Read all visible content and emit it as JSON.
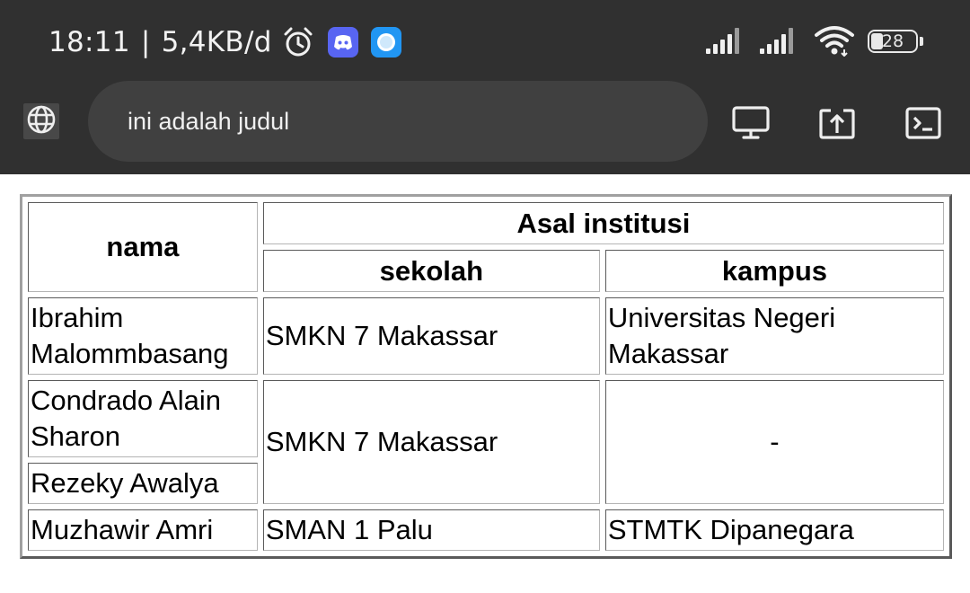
{
  "status_bar": {
    "time": "18:11",
    "separator": "|",
    "net_speed": "5,4KB/d",
    "battery_level": "28",
    "battery_fraction": 0.28
  },
  "toolbar": {
    "url_text": "ini adalah judul"
  },
  "table": {
    "header": {
      "nama": "nama",
      "asal": "Asal institusi",
      "sekolah": "sekolah",
      "kampus": "kampus"
    },
    "rows": [
      {
        "nama": "Ibrahim Malommbasang",
        "sekolah": "SMKN 7 Makassar",
        "kampus": "Universitas Negeri Makassar"
      },
      {
        "nama": "Condrado Alain Sharon",
        "sekolah": "SMKN 7 Makassar",
        "kampus": "-"
      },
      {
        "nama": "Rezeky Awalya"
      },
      {
        "nama": "Muzhawir Amri",
        "sekolah": "SMAN 1 Palu",
        "kampus": "STMTK Dipanegara"
      }
    ]
  },
  "colors": {
    "chrome_bg": "#303030",
    "urlbar_bg": "#404040",
    "discord": "#5865f2",
    "app_icon": "#2196f3"
  }
}
